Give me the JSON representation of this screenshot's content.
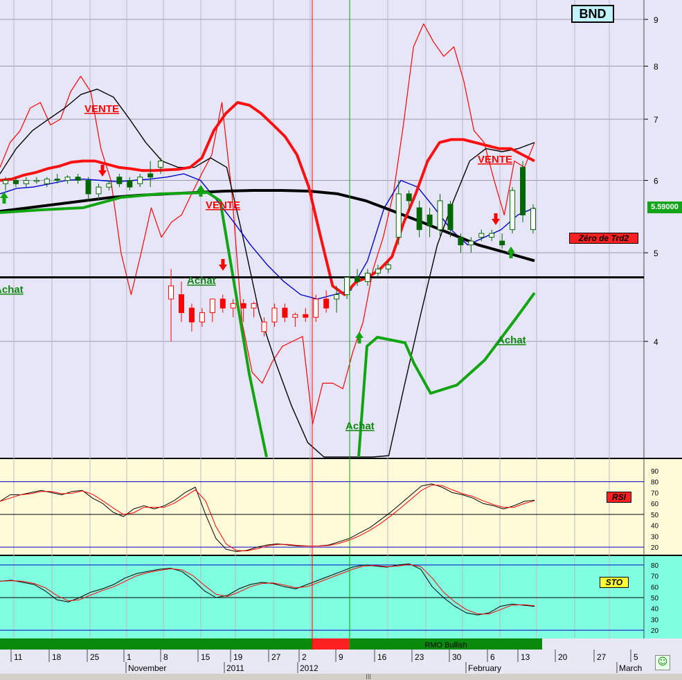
{
  "app": {
    "ticker": "BND",
    "last_price": "5.59000",
    "smiley_icon": "smiley-icon",
    "scroll_grip": "|||"
  },
  "colors": {
    "price_bg": "#e6e6f8",
    "osc_bg": "#fffbd9",
    "sto_bg": "#7fffe0",
    "buy": "#118811",
    "sell": "#ff0000"
  },
  "price_axis": {
    "ticks": [
      "9",
      "8",
      "7",
      "6",
      "5",
      "4"
    ]
  },
  "tags": {
    "zero_trd2": "Zéro de Trd2",
    "rsi": "RSI",
    "sto": "STO"
  },
  "annotations": [
    {
      "text": "VENTE",
      "color": "#ff0000"
    },
    {
      "text": "VENTE",
      "color": "#ff0000"
    },
    {
      "text": "VENTE",
      "color": "#ff0000"
    },
    {
      "text": "Achat",
      "color": "#118811"
    },
    {
      "text": "Achat",
      "color": "#118811"
    },
    {
      "text": "Achat",
      "color": "#118811"
    },
    {
      "text": "Achat",
      "color": "#118811"
    }
  ],
  "rmo_bar": {
    "label": "RMO Bullish"
  },
  "date_axis": {
    "days": [
      "11",
      "18",
      "25",
      "1",
      "8",
      "15",
      "19",
      "27",
      "2",
      "9",
      "16",
      "23",
      "30",
      "6",
      "13",
      "20",
      "27",
      "5"
    ],
    "months": [
      "November",
      "2011",
      "2012",
      "February",
      "March"
    ]
  },
  "chart_data": {
    "type": "candlestick",
    "title": "BND",
    "price_ylim": [
      3.0,
      9.3
    ],
    "price_ticks": [
      9,
      8,
      7,
      6,
      5,
      4
    ],
    "candles": [
      {
        "o": 5.95,
        "h": 6.05,
        "l": 5.85,
        "c": 6.0
      },
      {
        "o": 6.0,
        "h": 6.05,
        "l": 5.9,
        "c": 5.95
      },
      {
        "o": 5.95,
        "h": 6.05,
        "l": 5.9,
        "c": 6.0
      },
      {
        "o": 6.0,
        "h": 6.05,
        "l": 5.95,
        "c": 6.0
      },
      {
        "o": 5.95,
        "h": 6.05,
        "l": 5.9,
        "c": 6.02
      },
      {
        "o": 6.02,
        "h": 6.1,
        "l": 5.95,
        "c": 6.0
      },
      {
        "o": 6.0,
        "h": 6.08,
        "l": 5.95,
        "c": 6.05
      },
      {
        "o": 6.05,
        "h": 6.1,
        "l": 5.95,
        "c": 6.0
      },
      {
        "o": 6.0,
        "h": 6.05,
        "l": 5.7,
        "c": 5.8
      },
      {
        "o": 5.8,
        "h": 5.95,
        "l": 5.7,
        "c": 5.9
      },
      {
        "o": 5.9,
        "h": 6.0,
        "l": 5.85,
        "c": 5.95
      },
      {
        "o": 6.05,
        "h": 6.1,
        "l": 5.9,
        "c": 5.95
      },
      {
        "o": 6.0,
        "h": 6.05,
        "l": 5.85,
        "c": 5.9
      },
      {
        "o": 5.95,
        "h": 6.1,
        "l": 5.9,
        "c": 6.05
      },
      {
        "o": 6.1,
        "h": 6.3,
        "l": 5.9,
        "c": 6.05
      },
      {
        "o": 6.2,
        "h": 6.35,
        "l": 6.1,
        "c": 6.3
      },
      {
        "o": 4.45,
        "h": 4.8,
        "l": 4.0,
        "c": 4.6
      },
      {
        "o": 4.5,
        "h": 4.65,
        "l": 4.2,
        "c": 4.3
      },
      {
        "o": 4.35,
        "h": 4.4,
        "l": 4.1,
        "c": 4.2
      },
      {
        "o": 4.2,
        "h": 4.35,
        "l": 4.15,
        "c": 4.3
      },
      {
        "o": 4.3,
        "h": 4.45,
        "l": 4.2,
        "c": 4.45
      },
      {
        "o": 4.45,
        "h": 4.5,
        "l": 4.3,
        "c": 4.35
      },
      {
        "o": 4.35,
        "h": 4.45,
        "l": 4.25,
        "c": 4.4
      },
      {
        "o": 4.4,
        "h": 4.45,
        "l": 4.2,
        "c": 4.35
      },
      {
        "o": 4.35,
        "h": 4.42,
        "l": 4.25,
        "c": 4.4
      },
      {
        "o": 4.1,
        "h": 4.25,
        "l": 4.05,
        "c": 4.2
      },
      {
        "o": 4.2,
        "h": 4.4,
        "l": 4.15,
        "c": 4.35
      },
      {
        "o": 4.35,
        "h": 4.4,
        "l": 4.2,
        "c": 4.25
      },
      {
        "o": 4.25,
        "h": 4.3,
        "l": 4.15,
        "c": 4.28
      },
      {
        "o": 4.28,
        "h": 4.35,
        "l": 4.2,
        "c": 4.25
      },
      {
        "o": 4.25,
        "h": 4.5,
        "l": 4.2,
        "c": 4.45
      },
      {
        "o": 4.45,
        "h": 4.55,
        "l": 4.3,
        "c": 4.35
      },
      {
        "o": 4.45,
        "h": 4.6,
        "l": 4.3,
        "c": 4.5
      },
      {
        "o": 4.5,
        "h": 4.7,
        "l": 4.45,
        "c": 4.7
      },
      {
        "o": 4.7,
        "h": 4.8,
        "l": 4.6,
        "c": 4.65
      },
      {
        "o": 4.65,
        "h": 4.8,
        "l": 4.6,
        "c": 4.75
      },
      {
        "o": 4.75,
        "h": 4.85,
        "l": 4.7,
        "c": 4.8
      },
      {
        "o": 4.8,
        "h": 4.9,
        "l": 4.75,
        "c": 4.85
      },
      {
        "o": 5.2,
        "h": 6.0,
        "l": 5.1,
        "c": 5.8
      },
      {
        "o": 5.8,
        "h": 5.85,
        "l": 5.55,
        "c": 5.7
      },
      {
        "o": 5.6,
        "h": 5.7,
        "l": 5.2,
        "c": 5.3
      },
      {
        "o": 5.5,
        "h": 5.6,
        "l": 5.2,
        "c": 5.35
      },
      {
        "o": 5.3,
        "h": 5.8,
        "l": 5.2,
        "c": 5.7
      },
      {
        "o": 5.65,
        "h": 5.7,
        "l": 5.2,
        "c": 5.3
      },
      {
        "o": 5.2,
        "h": 5.25,
        "l": 5.0,
        "c": 5.1
      },
      {
        "o": 5.1,
        "h": 5.2,
        "l": 5.0,
        "c": 5.15
      },
      {
        "o": 5.2,
        "h": 5.3,
        "l": 5.15,
        "c": 5.25
      },
      {
        "o": 5.2,
        "h": 5.3,
        "l": 5.15,
        "c": 5.25
      },
      {
        "o": 5.15,
        "h": 5.25,
        "l": 5.05,
        "c": 5.1
      },
      {
        "o": 5.3,
        "h": 5.9,
        "l": 5.25,
        "c": 5.85
      },
      {
        "o": 6.2,
        "h": 6.3,
        "l": 5.4,
        "c": 5.5
      },
      {
        "o": 5.3,
        "h": 5.65,
        "l": 5.25,
        "c": 5.59
      }
    ],
    "series": [
      {
        "name": "RMO Bullish",
        "color": "#00aa00"
      }
    ],
    "lines": {
      "red_thin": [
        6.2,
        6.6,
        6.8,
        7.2,
        7.3,
        6.9,
        7.0,
        7.5,
        7.8,
        7.5,
        6.5,
        6.0,
        5.0,
        4.5,
        5.0,
        5.6,
        5.2,
        5.4,
        5.5,
        5.8,
        6.1,
        6.4,
        7.3,
        5.8,
        4.2,
        3.7,
        3.6,
        3.8,
        3.95,
        4.0,
        4.05,
        3.25,
        3.6,
        3.6,
        3.55,
        3.9,
        4.2,
        4.8,
        5.2,
        5.8,
        6.9,
        8.4,
        8.9,
        8.5,
        8.2,
        8.4,
        7.7,
        6.8,
        6.6,
        6.0,
        5.5,
        6.3,
        6.2,
        6.6
      ],
      "red_thick": [
        6.0,
        6.02,
        6.08,
        6.12,
        6.18,
        6.22,
        6.28,
        6.3,
        6.3,
        6.25,
        6.2,
        6.18,
        6.15,
        6.15,
        6.16,
        6.17,
        6.2,
        6.35,
        6.8,
        7.1,
        7.3,
        7.25,
        7.1,
        6.9,
        6.7,
        6.4,
        5.9,
        5.2,
        4.6,
        4.5,
        4.65,
        4.7,
        4.8,
        4.95,
        5.4,
        5.8,
        6.3,
        6.6,
        6.65,
        6.65,
        6.6,
        6.55,
        6.5,
        6.5,
        6.4,
        6.3
      ],
      "black_thick": [
        5.55,
        5.6,
        5.65,
        5.7,
        5.75,
        5.78,
        5.8,
        5.82,
        5.84,
        5.85,
        5.85,
        5.84,
        5.8,
        5.7,
        5.55,
        5.4,
        5.25,
        5.1,
        5.0,
        4.9
      ],
      "black_thin": [
        6.1,
        6.5,
        6.8,
        7.0,
        7.2,
        7.45,
        7.55,
        7.4,
        7.0,
        6.6,
        6.3,
        6.2,
        6.2,
        6.35,
        6.2,
        5.2,
        4.3,
        3.8,
        3.4,
        3.1,
        2.9,
        2.75,
        2.7,
        2.75,
        3.0,
        3.6,
        4.3,
        5.1,
        5.7,
        6.3,
        6.5,
        6.45,
        6.5,
        6.6
      ],
      "blue": [
        5.8,
        5.88,
        5.9,
        5.95,
        6.0,
        6.02,
        6.0,
        5.98,
        6.0,
        6.02,
        6.05,
        6.1,
        6.0,
        5.7,
        5.4,
        5.1,
        4.85,
        4.65,
        4.5,
        4.45,
        4.5,
        4.55,
        4.9,
        5.6,
        6.0,
        5.9,
        5.6,
        5.3,
        5.1,
        5.2,
        5.3,
        5.5,
        5.6
      ]
    },
    "horizontal_line": 4.7,
    "rsi": {
      "ylim": [
        15,
        95
      ],
      "ticks": [
        90,
        80,
        70,
        60,
        50,
        40,
        30,
        20
      ],
      "levels": [
        80,
        50,
        20
      ],
      "values": [
        62,
        68,
        68,
        70,
        72,
        70,
        68,
        71,
        72,
        65,
        60,
        52,
        48,
        55,
        58,
        55,
        58,
        63,
        70,
        75,
        50,
        28,
        18,
        16,
        17,
        20,
        22,
        23,
        22,
        21,
        21,
        21,
        22,
        25,
        28,
        33,
        38,
        45,
        52,
        60,
        68,
        76,
        78,
        75,
        70,
        68,
        65,
        60,
        58,
        55,
        58,
        62,
        63
      ]
    },
    "sto": {
      "ylim": [
        15,
        85
      ],
      "ticks": [
        80,
        70,
        60,
        50,
        40,
        30,
        20
      ],
      "levels": [
        80,
        50,
        20
      ],
      "values": [
        65,
        66,
        64,
        62,
        56,
        48,
        46,
        50,
        55,
        58,
        62,
        68,
        72,
        74,
        76,
        77,
        74,
        66,
        56,
        50,
        52,
        58,
        62,
        64,
        63,
        60,
        58,
        62,
        66,
        70,
        74,
        78,
        80,
        79,
        78,
        80,
        81,
        76,
        60,
        50,
        42,
        36,
        34,
        36,
        42,
        44,
        43,
        42
      ]
    },
    "rmo": {
      "segments": [
        "bullish",
        "bearish",
        "bullish"
      ]
    }
  }
}
